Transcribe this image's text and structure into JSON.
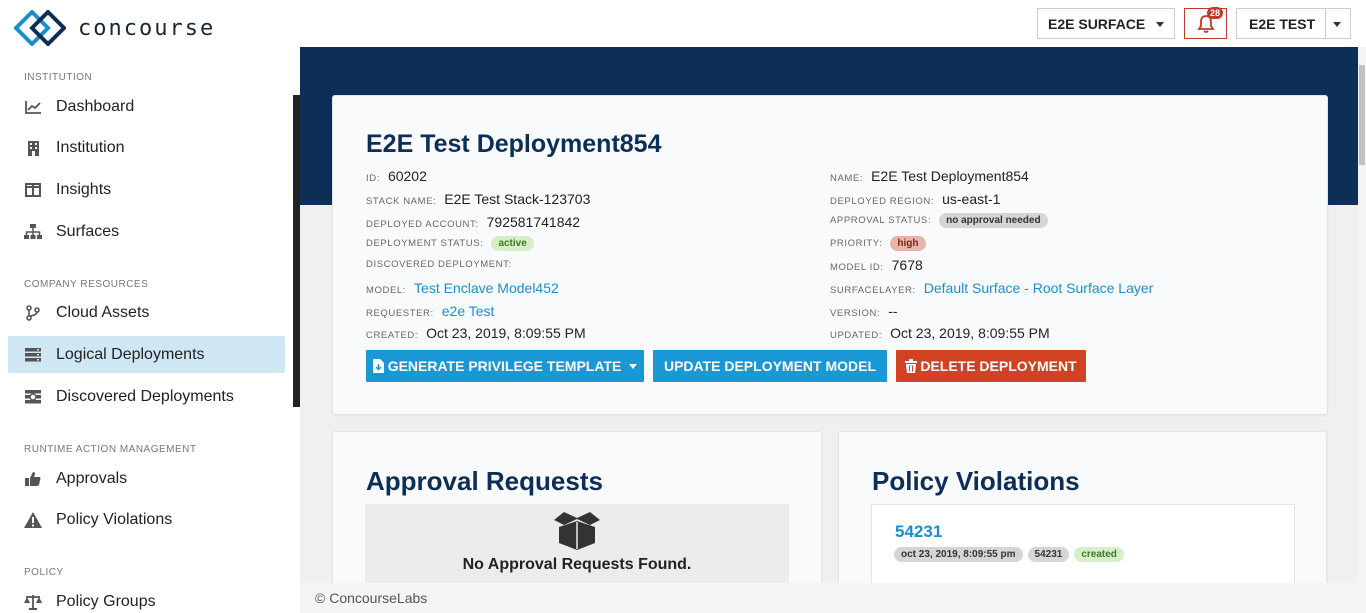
{
  "brand": {
    "name": "concourse"
  },
  "topbar": {
    "surface_label": "E2E SURFACE",
    "notification_count": "28",
    "user_label": "E2E TEST"
  },
  "sidebar": {
    "sections": [
      {
        "title": "INSTITUTION",
        "items": [
          {
            "label": "Dashboard",
            "icon": "line-chart-icon"
          },
          {
            "label": "Institution",
            "icon": "building-icon"
          },
          {
            "label": "Insights",
            "icon": "columns-icon"
          },
          {
            "label": "Surfaces",
            "icon": "sitemap-icon"
          }
        ]
      },
      {
        "title": "COMPANY RESOURCES",
        "items": [
          {
            "label": "Cloud Assets",
            "icon": "branch-icon"
          },
          {
            "label": "Logical Deployments",
            "icon": "server-icon",
            "active": true
          },
          {
            "label": "Discovered Deployments",
            "icon": "discover-icon"
          }
        ]
      },
      {
        "title": "RUNTIME ACTION MANAGEMENT",
        "items": [
          {
            "label": "Approvals",
            "icon": "thumbs-up-icon"
          },
          {
            "label": "Policy Violations",
            "icon": "warning-icon"
          }
        ]
      },
      {
        "title": "POLICY",
        "items": [
          {
            "label": "Policy Groups",
            "icon": "balance-scale-icon"
          }
        ]
      }
    ]
  },
  "deployment": {
    "title": "E2E Test Deployment854",
    "left_fields": [
      {
        "key": "ID:",
        "value": "60202"
      },
      {
        "key": "STACK NAME:",
        "value": "E2E Test Stack-123703"
      },
      {
        "key": "DEPLOYED ACCOUNT:",
        "value": "792581741842"
      },
      {
        "key": "DEPLOYMENT STATUS:",
        "value": "active"
      },
      {
        "key": "DISCOVERED DEPLOYMENT:",
        "value": ""
      },
      {
        "key": "MODEL:",
        "value": "Test Enclave Model452"
      },
      {
        "key": "REQUESTER:",
        "value": "e2e Test"
      },
      {
        "key": "CREATED:",
        "value": "Oct 23, 2019, 8:09:55 PM"
      }
    ],
    "right_fields": [
      {
        "key": "NAME:",
        "value": "E2E Test Deployment854"
      },
      {
        "key": "DEPLOYED REGION:",
        "value": "us-east-1"
      },
      {
        "key": "APPROVAL STATUS:",
        "value": "no approval needed"
      },
      {
        "key": "PRIORITY:",
        "value": "high"
      },
      {
        "key": "MODEL ID:",
        "value": "7678"
      },
      {
        "key": "SURFACELAYER:",
        "value": "Default Surface - Root Surface Layer"
      },
      {
        "key": "VERSION:",
        "value": "--"
      },
      {
        "key": "UPDATED:",
        "value": "Oct 23, 2019, 8:09:55 PM"
      }
    ],
    "actions": {
      "generate": "GENERATE PRIVILEGE TEMPLATE",
      "update": "UPDATE DEPLOYMENT MODEL",
      "delete": "DELETE DEPLOYMENT"
    }
  },
  "approvals": {
    "title": "Approval Requests",
    "empty_text": "No Approval Requests Found."
  },
  "violations": {
    "title": "Policy Violations",
    "items": [
      {
        "id": "54231",
        "tags": [
          "oct 23, 2019, 8:09:55 pm",
          "54231",
          "created"
        ]
      }
    ]
  },
  "footer": {
    "text": "© ConcourseLabs"
  },
  "colors": {
    "navy": "#0d2f57",
    "primary": "#1a97d5",
    "danger": "#d14222",
    "active_nav": "#cfe6f3"
  }
}
